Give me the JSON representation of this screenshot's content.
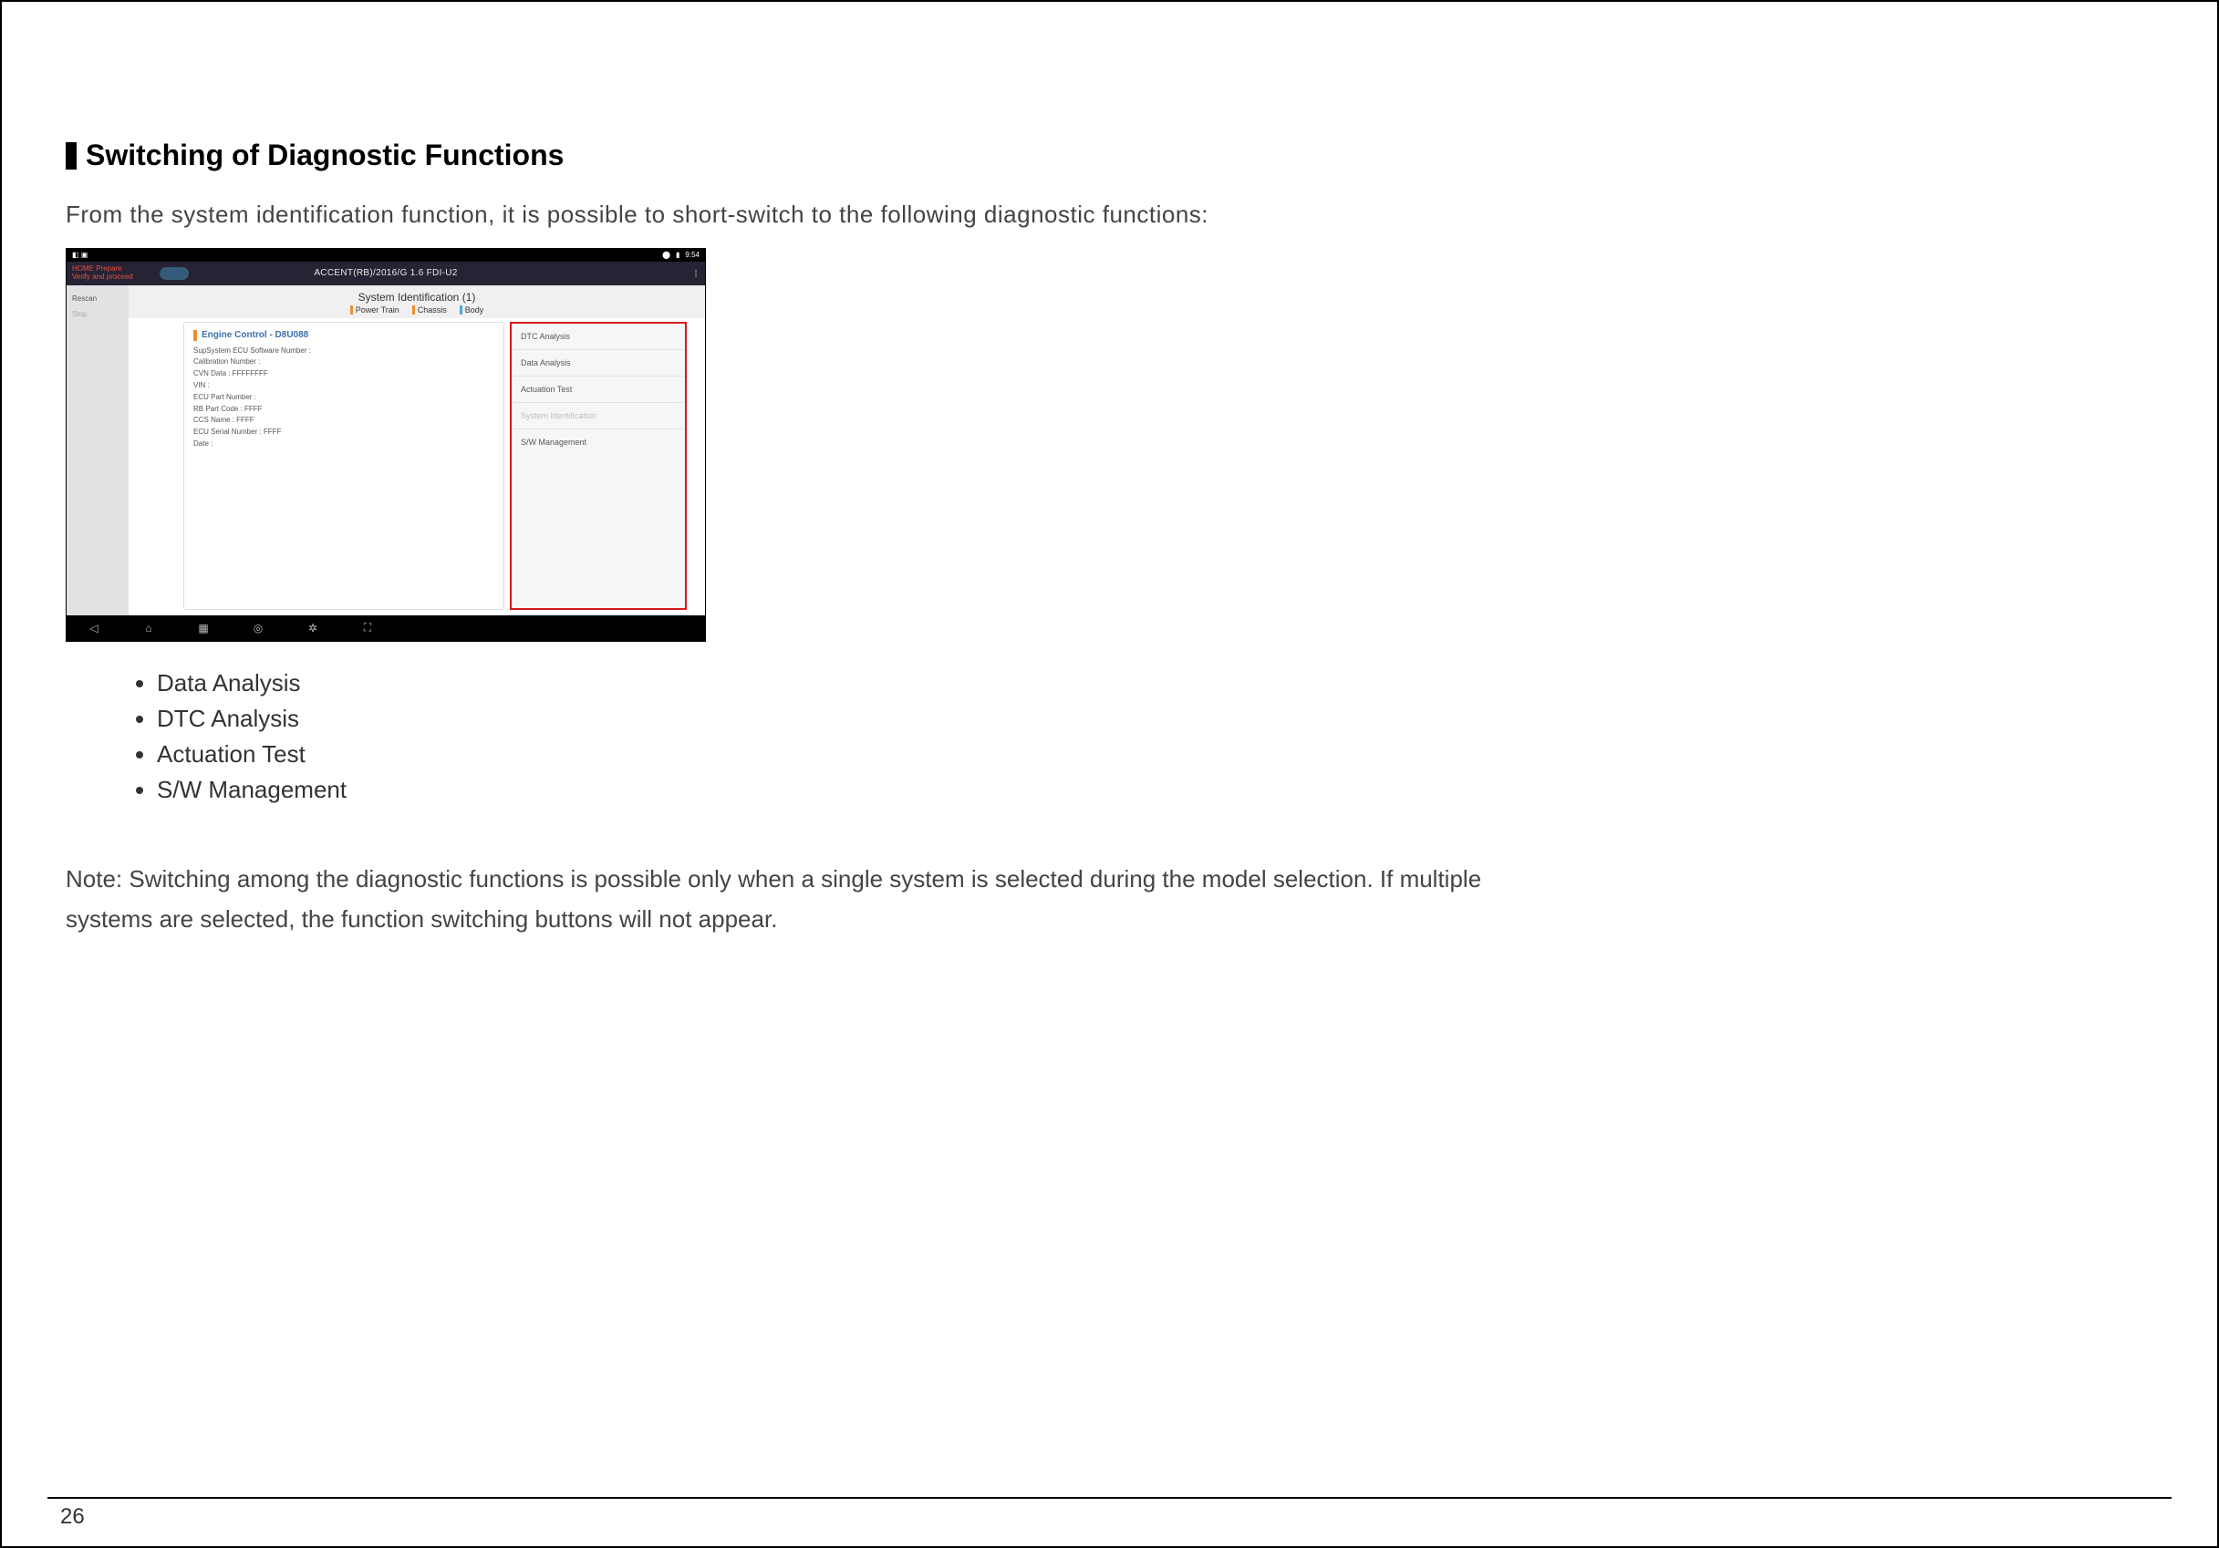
{
  "section": {
    "title": "Switching of Diagnostic Functions",
    "intro": "From the system identification function, it is possible to short-switch to the following diagnostic functions:"
  },
  "screenshot": {
    "status": {
      "left": "",
      "time": "9:54"
    },
    "header": {
      "badge_l1": "HOME Prepare",
      "badge_l2": "Verify and proceed",
      "vehicle": "ACCENT(RB)/2016/G 1.6 FDI-U2"
    },
    "left_tabs": {
      "rescan": "Rescan",
      "stop": "Stop"
    },
    "subtitle": "System Identification (1)",
    "filters": {
      "power": "Power Train",
      "chassis": "Chassis",
      "body": "Body"
    },
    "card": {
      "title": "Engine Control - D8U088",
      "lines": [
        "SupSystem ECU Software Number :",
        "Calibration Number :",
        "CVN Data : FFFFFFFF",
        "VIN :",
        "ECU Part Number :",
        "RB Part Code : FFFF",
        "CCS Name : FFFF",
        "ECU Serial Number : FFFF",
        "Date :"
      ]
    },
    "menu": {
      "items": [
        {
          "label": "DTC Analysis",
          "disabled": false
        },
        {
          "label": "Data Analysis",
          "disabled": false
        },
        {
          "label": "Actuation Test",
          "disabled": false
        },
        {
          "label": "System Identification",
          "disabled": true
        },
        {
          "label": "S/W Management",
          "disabled": false
        }
      ]
    }
  },
  "bullets": [
    "Data Analysis",
    "DTC Analysis",
    "Actuation Test",
    "S/W Management"
  ],
  "note": "Note: Switching among the diagnostic functions is possible only when a single system is selected during the model selection. If multiple systems are selected, the function switching buttons will not appear.",
  "page_number": "26"
}
